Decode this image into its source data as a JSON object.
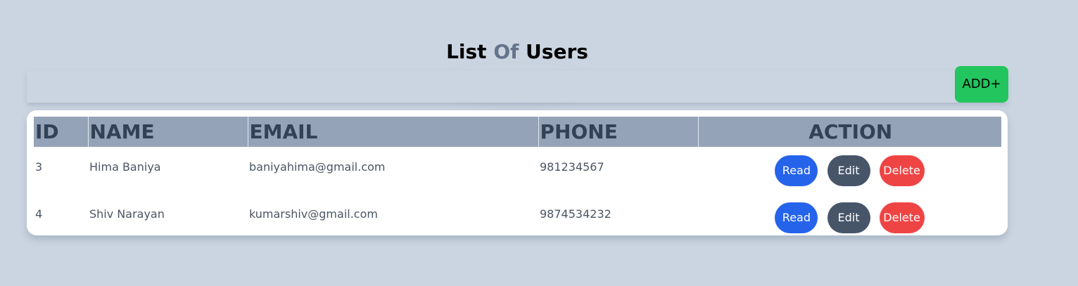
{
  "title": {
    "part1": "List",
    "part2": "Of",
    "part3": "Users"
  },
  "toolbar": {
    "add_label": "ADD+"
  },
  "table": {
    "headers": [
      "ID",
      "NAME",
      "EMAIL",
      "PHONE",
      "ACTION"
    ],
    "rows": [
      {
        "id": "3",
        "name": "Hima Baniya",
        "email": "baniyahima@gmail.com",
        "phone": "981234567"
      },
      {
        "id": "4",
        "name": "Shiv Narayan",
        "email": "kumarshiv@gmail.com",
        "phone": "9874534232"
      }
    ],
    "actions": {
      "read": "Read",
      "edit": "Edit",
      "delete": "Delete"
    }
  },
  "colors": {
    "background": "#cbd5e1",
    "add_button": "#22c55e",
    "header_bg": "#94a3b8",
    "read_button": "#2563eb",
    "edit_button": "#475569",
    "delete_button": "#ef4444"
  }
}
